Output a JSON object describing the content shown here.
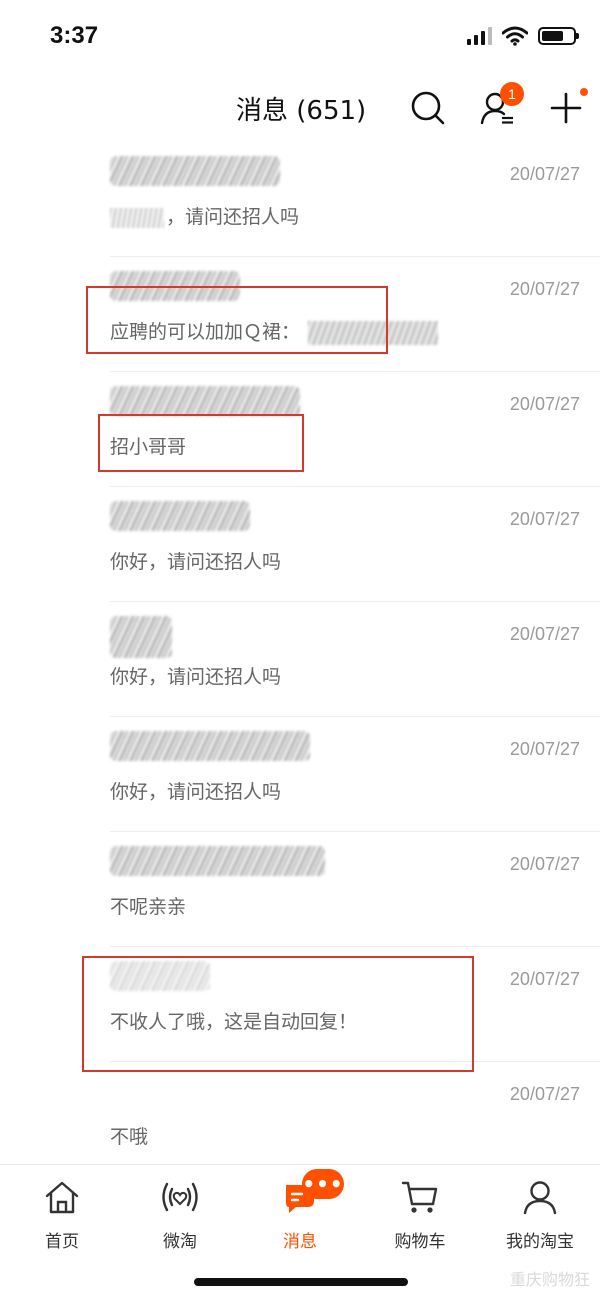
{
  "status_bar": {
    "time": "3:37"
  },
  "header": {
    "title": "消息 (651)",
    "contacts_badge": "1",
    "icons": {
      "search": "search-icon",
      "contacts": "contacts-icon",
      "add": "plus-icon"
    }
  },
  "messages": [
    {
      "date": "20/07/27",
      "text": "，请问还招人吗"
    },
    {
      "date": "20/07/27",
      "text": "应聘的可以加加Ｑ裙："
    },
    {
      "date": "20/07/27",
      "text": "招小哥哥"
    },
    {
      "date": "20/07/27",
      "text": "你好，请问还招人吗"
    },
    {
      "date": "20/07/27",
      "text": "你好，请问还招人吗"
    },
    {
      "date": "20/07/27",
      "text": "你好，请问还招人吗"
    },
    {
      "date": "20/07/27",
      "text": "不呢亲亲"
    },
    {
      "date": "20/07/27",
      "text": "不收人了哦，这是自动回复！"
    },
    {
      "date": "20/07/27",
      "text": "不哦"
    }
  ],
  "tab_bar": {
    "items": [
      {
        "label": "首页",
        "icon": "home-icon"
      },
      {
        "label": "微淘",
        "icon": "broadcast-heart-icon"
      },
      {
        "label": "消息",
        "icon": "chat-bubble-icon",
        "active": true,
        "badge": "•••"
      },
      {
        "label": "购物车",
        "icon": "cart-icon"
      },
      {
        "label": "我的淘宝",
        "icon": "user-icon"
      }
    ]
  },
  "watermark": "重庆购物狂",
  "colors": {
    "accent": "#ff5000",
    "highlight_box": "#d33a2c"
  }
}
